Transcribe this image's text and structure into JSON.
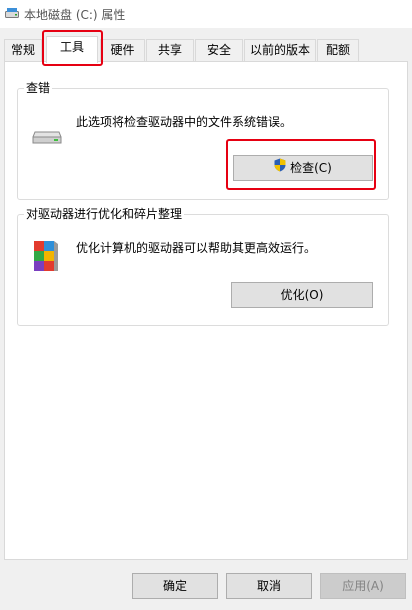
{
  "window": {
    "title": "本地磁盘 (C:) 属性",
    "title_icon": "drive-icon"
  },
  "tabs": [
    {
      "label": "常规",
      "active": false
    },
    {
      "label": "工具",
      "active": true
    },
    {
      "label": "硬件",
      "active": false
    },
    {
      "label": "共享",
      "active": false
    },
    {
      "label": "安全",
      "active": false
    },
    {
      "label": "以前的版本",
      "active": false
    },
    {
      "label": "配额",
      "active": false
    }
  ],
  "error_checking": {
    "title": "查错",
    "description": "此选项将检查驱动器中的文件系统错误。",
    "button_label": "检查(C)",
    "icon": "drive-icon",
    "button_icon": "uac-shield-icon"
  },
  "optimize": {
    "title": "对驱动器进行优化和碎片整理",
    "description": "优化计算机的驱动器可以帮助其更高效运行。",
    "button_label": "优化(O)",
    "icon": "defrag-icon"
  },
  "footer": {
    "ok_label": "确定",
    "cancel_label": "取消",
    "apply_label": "应用(A)"
  },
  "colors": {
    "highlight": "#e60012",
    "panel_bg": "#ffffff",
    "window_bg": "#f0f0f0"
  }
}
